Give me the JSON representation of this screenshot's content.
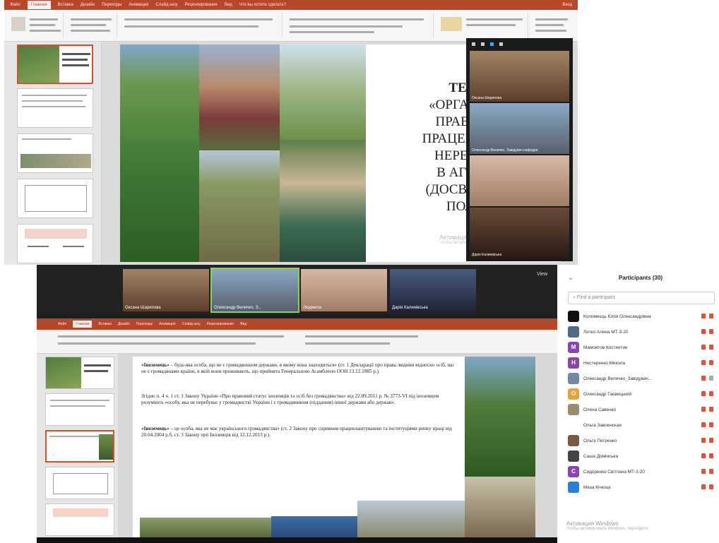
{
  "top": {
    "ribbon_tabs": [
      "Файл",
      "Главная",
      "Вставка",
      "Дизайн",
      "Переходы",
      "Анимация",
      "Слайд-шоу",
      "Рецензирование",
      "Вид",
      "Что вы хотите сделать?"
    ],
    "ribbon_right": "Вход",
    "slide_title": [
      "ТЕМ",
      "«ОРГАНІЗА",
      "ПРАВОВІ",
      "ПРАЦЕВЛАШ",
      "НЕРЕЗИД",
      "В АГРОБ",
      "(ДОСВІД УК",
      "ПОЛЬ"
    ],
    "activate_line1": "Активация Windows",
    "activate_line2": "Чтобы активировать Windows, перейдите",
    "zoom_tiles": [
      {
        "name": "Оксана Шарипова",
        "color": "#7a5a3e"
      },
      {
        "name": "Олександр Величко, Завідувач кафедри",
        "color": "#6f8aa6"
      },
      {
        "name": "",
        "color": "#b8917c"
      },
      {
        "name": "Дарія Калинівська",
        "color": "#5a3a2e"
      }
    ]
  },
  "bottom": {
    "video_strip": [
      {
        "name": "Оксана Шарипова",
        "color": "#7a5a3e",
        "active": false
      },
      {
        "name": "Олександр Величко, З...",
        "color": "#6f8aa6",
        "active": true
      },
      {
        "name": "Людмила",
        "color": "#b8917c",
        "active": false
      },
      {
        "name": "Дарія Калинівська",
        "color": "#3a4a72",
        "active": false
      }
    ],
    "view_label": "View",
    "slide_paragraphs": [
      {
        "bold": "«Іноземець»",
        "text": " – будь-яка особа, що не є громадянином держави, в якому вона знаходиться» (ст. 1 Декларації про права людини відносно осіб, що не є громадянами країни, в якій вони проживають, що прийнята Генеральною Асамблеєю ООН 13.12.1985 р.)."
      },
      {
        "bold": "",
        "text": "Згідно п. 4 ч. 1 ст. 1 Закону України «Про правовий статус іноземців та осіб без громадянства» від 22.09.2011 р. № 3773-VI під іноземцем розуміють «особу, яка не перебуває у громадянстві України і є громадянином (підданим) іншої держави або держав»."
      },
      {
        "bold": "«Іноземець»",
        "text": " – це особа, яка не має українського громадянства» (ст. 2 Закону про сприяння працевлаштуванню та інституціями ринку праці від 20.04.2004 р.б, ст. 3 Закону про Іноземців від 12.12.2013 р.)."
      }
    ]
  },
  "participants": {
    "title": "Participants (30)",
    "search_placeholder": "Find a participant",
    "list": [
      {
        "name": "Коломиєць Юлія Олександрівна",
        "initial": "",
        "color": "#111111"
      },
      {
        "name": "Литко Алина МТ-3-20",
        "initial": "",
        "color": "#4d6b8a"
      },
      {
        "name": "Мамонтов Костянтин",
        "initial": "М",
        "color": "#8e44ad"
      },
      {
        "name": "Нестеренко Микола",
        "initial": "Н",
        "color": "#8e44ad"
      },
      {
        "name": "Олександр Величко_Завідувач...",
        "initial": "",
        "color": "#6f8aa6"
      },
      {
        "name": "Олександр Гаєвецький",
        "initial": "О",
        "color": "#e8a33b"
      },
      {
        "name": "Олена Савенко",
        "initial": "",
        "color": "#9b8a6a"
      },
      {
        "name": "Ольга Завоенская",
        "initial": "",
        "color": "#ffffff"
      },
      {
        "name": "Ольга Петренко",
        "initial": "",
        "color": "#7a5a3e"
      },
      {
        "name": "Саша Домінська",
        "initial": "",
        "color": "#444444"
      },
      {
        "name": "Сидоренко Світлана МТ-3-20",
        "initial": "С",
        "color": "#8e44ad"
      },
      {
        "name": "Міша Кічкоші",
        "initial": "",
        "color": "#2a7fd4"
      }
    ]
  },
  "watermark": {
    "line1": "Активация Windows",
    "line2": "Чтобы активировать Windows, перейдите"
  }
}
